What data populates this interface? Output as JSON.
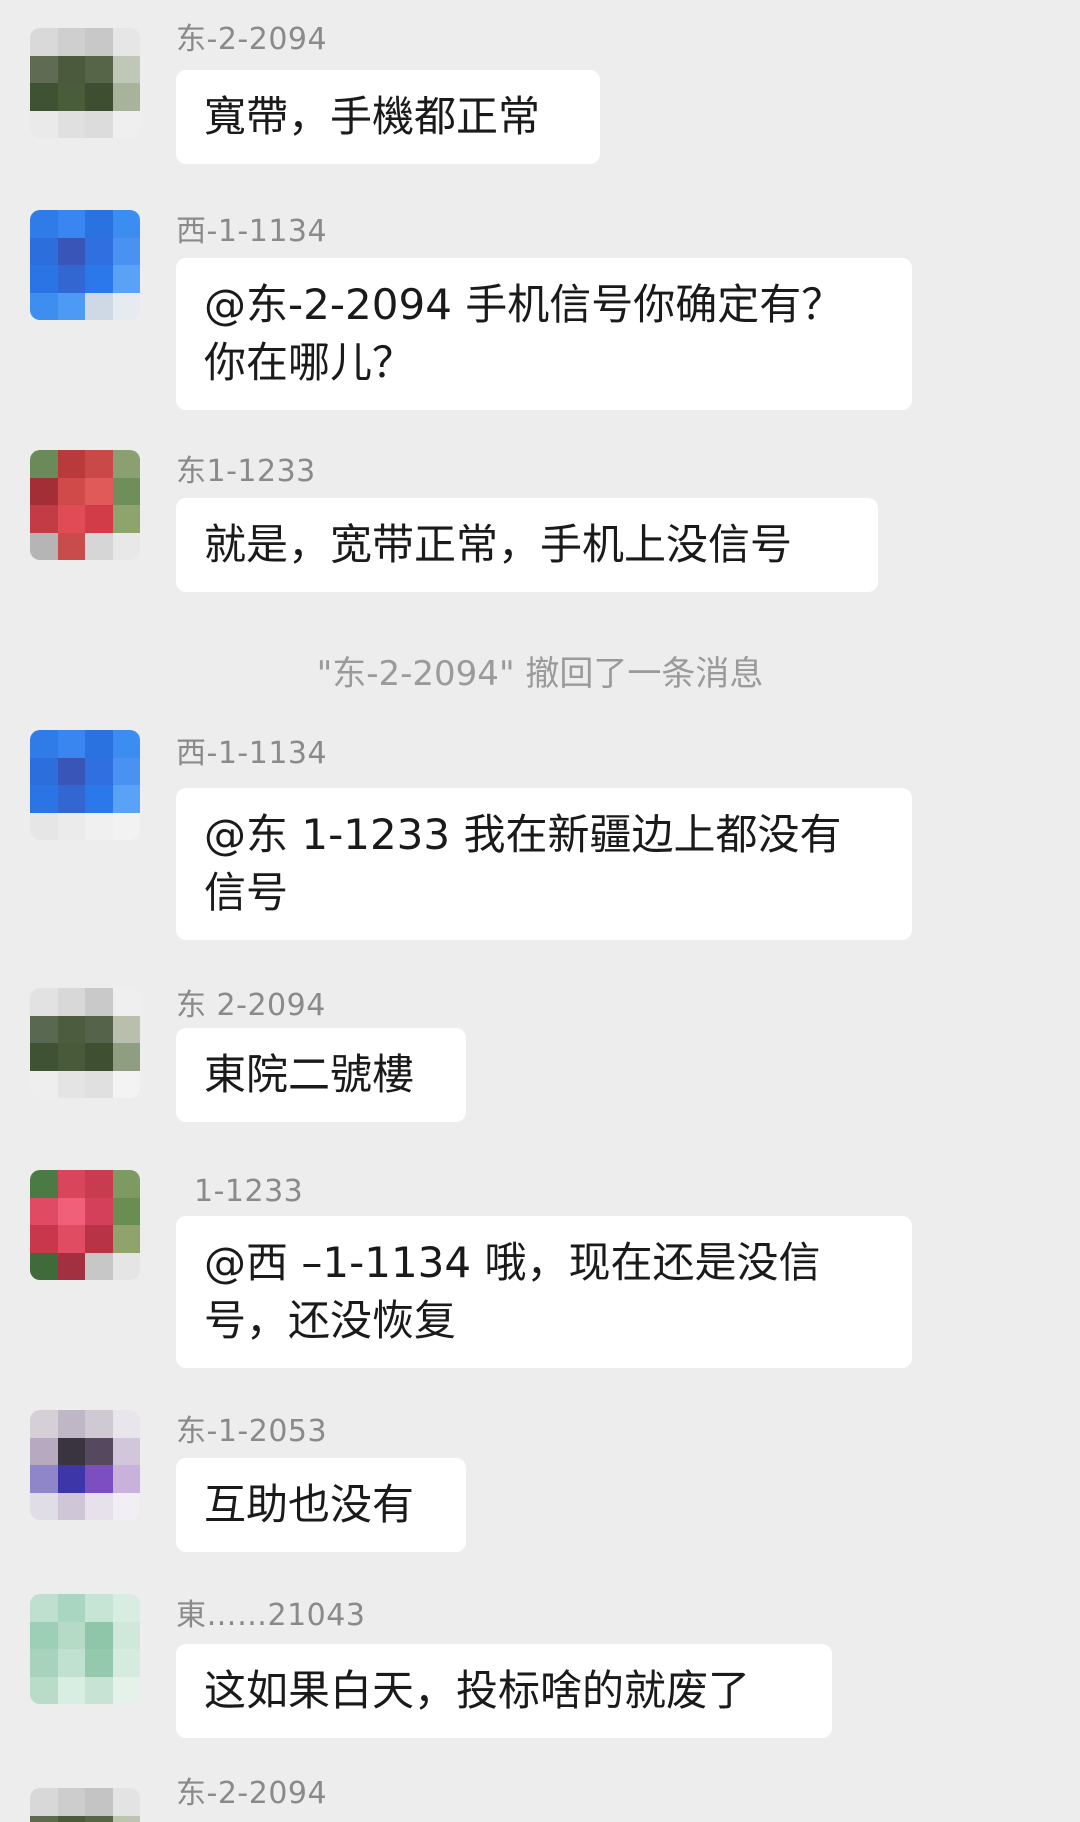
{
  "messages": [
    {
      "sender": "东-2-2094",
      "text": "寬帶，手機都正常",
      "avatar_colors": [
        "#d9d9d9",
        "#cfcfcf",
        "#c8c8c8",
        "#e6e6e6",
        "#5f6b52",
        "#4b5a3c",
        "#566448",
        "#bfc7b6",
        "#3f5234",
        "#4a5d3a",
        "#3d4f30",
        "#a7b39a",
        "#eaeaea",
        "#e0e0e0",
        "#dcdcdc",
        "#efefef"
      ]
    },
    {
      "sender": "西-1-1134",
      "text": "@东-2-2094 手机信号你确定有？\n你在哪儿？",
      "avatar_colors": [
        "#2f7be8",
        "#3a86f0",
        "#2a72e0",
        "#3b8df2",
        "#2c6fdc",
        "#3a55b8",
        "#2f6fe0",
        "#4a92f2",
        "#2a74e6",
        "#3266d0",
        "#2b78ea",
        "#5aa2f5",
        "#3e8ef0",
        "#4d9af4",
        "#cfd9e6",
        "#e6ebf2"
      ]
    },
    {
      "sender": "东1-1233",
      "text": "就是，宽带正常，手机上没信号",
      "avatar_colors": [
        "#6b8a5a",
        "#b83a3a",
        "#c94848",
        "#8aa070",
        "#a42e35",
        "#d14a4a",
        "#e05a5a",
        "#6f8f5a",
        "#c23b45",
        "#e04c55",
        "#d23c48",
        "#8da46d",
        "#b5b5b5",
        "#c94c4c",
        "#d6d6d6",
        "#e8e8e8"
      ]
    },
    {
      "sender": "西-1-1134",
      "text": "@东 1-1233 我在新疆边上都没有\n信号",
      "avatar_colors": [
        "#2f7be8",
        "#3a86f0",
        "#2a72e0",
        "#3b8df2",
        "#2c6fdc",
        "#3a55b8",
        "#2f6fe0",
        "#4a92f2",
        "#2a74e6",
        "#3266d0",
        "#2b78ea",
        "#5aa2f5",
        "#e6e6e6",
        "#ebebeb",
        "#f0f0f0",
        "#f2f2f2"
      ]
    },
    {
      "sender": "东 2-2094",
      "text": "東院二號樓",
      "avatar_colors": [
        "#e2e2e2",
        "#d8d8d8",
        "#c9c9c9",
        "#efefef",
        "#596850",
        "#4c5c3e",
        "#55634a",
        "#b8c0ad",
        "#3f5234",
        "#485a39",
        "#3e5031",
        "#8f9d80",
        "#eeeeee",
        "#e4e4e4",
        "#e0e0e0",
        "#f3f3f3"
      ]
    },
    {
      "sender": "1-1233",
      "text": "@西 –1-1134 哦，现在还是没信\n号，还没恢复",
      "avatar_colors": [
        "#4c7a44",
        "#d9455a",
        "#c93b4f",
        "#7d9a62",
        "#e04a63",
        "#f06078",
        "#d4405a",
        "#6a8d52",
        "#c9374d",
        "#e04c62",
        "#b93347",
        "#8fa36a",
        "#3f6a3a",
        "#a33040",
        "#c7c7c7",
        "#e5e5e5"
      ]
    },
    {
      "sender": "东-1-2053",
      "text": "互助也没有",
      "avatar_colors": [
        "#d5d0d8",
        "#bfb6c6",
        "#cfc9d3",
        "#e9e5ec",
        "#b7a9c0",
        "#3a3440",
        "#56485f",
        "#d2c6da",
        "#8f86c9",
        "#3d36a8",
        "#7b4fc0",
        "#c8b2dc",
        "#e1dde6",
        "#cfc6d8",
        "#e6e1ea",
        "#f1eff3"
      ]
    },
    {
      "sender": "東……21043",
      "text": "这如果白天，投标啥的就废了",
      "avatar_colors": [
        "#bfe0cf",
        "#a9d6c0",
        "#c7e5d5",
        "#d8ede2",
        "#9ccfb5",
        "#b5dbc7",
        "#8fc6aa",
        "#cfe8da",
        "#a7d3bd",
        "#c0e1cf",
        "#94c9ae",
        "#d4ebde",
        "#b9dcc9",
        "#d9eee3",
        "#c6e3d4",
        "#e4f2ea"
      ]
    },
    {
      "sender": "东-2-2094",
      "text": "",
      "avatar_colors": [
        "#d8d8d8",
        "#cdcdcd",
        "#c4c4c4",
        "#e3e3e3",
        "#5e6a50",
        "#4b5a3c",
        "#566448",
        "#bcc5b2",
        "#3f5234",
        "#4a5d3a",
        "#3d4f30",
        "#a4b096",
        "#e9e9e9",
        "#dedede",
        "#dbdbdb",
        "#eeeeee"
      ]
    }
  ],
  "system_notice": "\"东-2-2094\" 撤回了一条消息"
}
